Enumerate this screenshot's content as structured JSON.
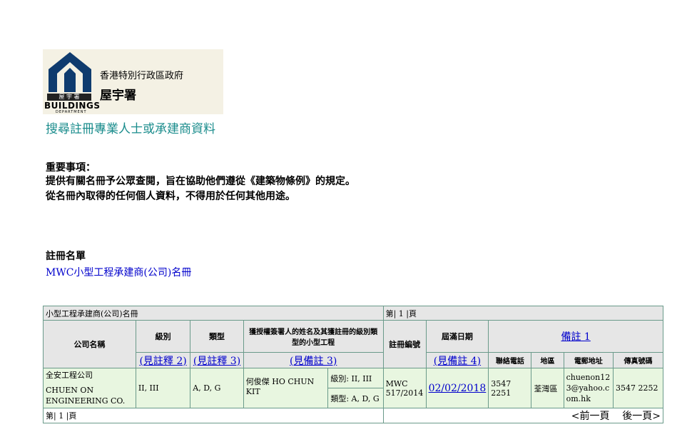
{
  "logo": {
    "sub_label": "屋 宇 署",
    "gov_text": "香港特別行政區政府",
    "dept_text": "屋宇署",
    "en_text": "BUILDINGS",
    "en_sub": "DEPARTMENT"
  },
  "page_title": "搜尋註冊專業人士或承建商資料",
  "notice": {
    "heading": "重要事項：",
    "line1": "提供有關名冊予公眾查閱，旨在協助他們遵從《建築物條例》的規定。",
    "line2": "從名冊內取得的任何個人資料，不得用於任何其他用途。"
  },
  "register": {
    "heading": "註冊名單",
    "link": "MWC小型工程承建商(公司)名冊"
  },
  "table": {
    "title": "小型工程承建商(公司)名冊",
    "page_indicator_top": "第| 1 |頁",
    "page_indicator_bottom": "第| 1 |頁",
    "headers": {
      "company": "公司名稱",
      "class": "級別",
      "type": "類型",
      "authorized": "獲授權簽署人的姓名及其獲註冊的級別類型的小型工程",
      "reg_no": "註冊編號",
      "expiry": "屆滿日期",
      "remark1": "備註 1",
      "phone": "聯絡電話",
      "district": "地區",
      "email": "電郵地址",
      "fax": "傳真號碼"
    },
    "notes": {
      "class": "(見註釋 2)",
      "type": "(見註釋 3)",
      "authorized": "(見備註 3)",
      "expiry": "(見備註 4)"
    },
    "rows": [
      {
        "company_zh": "全安工程公司",
        "company_en": "CHUEN ON ENGINEERING CO.",
        "class": "II, III",
        "type": "A, D, G",
        "signatory": "何俊傑 HO CHUN KIT",
        "sig_class": "級別: II, III",
        "sig_type": "類型: A, D, G",
        "reg_no": "MWC 517/2014",
        "expiry": "02/02/2018",
        "phone": "3547 2251",
        "district": "荃灣區",
        "email": "chuenon123@yahoo.com.hk",
        "fax": "3547 2252"
      }
    ],
    "pager": {
      "prev": "<前一頁",
      "next": "後一頁>"
    }
  }
}
